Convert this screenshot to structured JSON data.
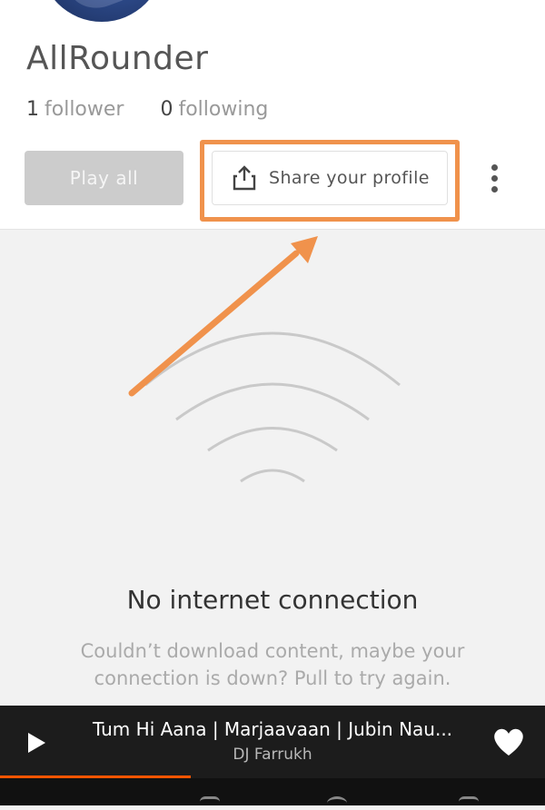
{
  "profile": {
    "username": "AllRounder",
    "followers_count": "1",
    "followers_label": "follower",
    "following_count": "0",
    "following_label": "following"
  },
  "actions": {
    "play_all_label": "Play all",
    "share_label": "Share your profile"
  },
  "empty_state": {
    "title": "No internet connection",
    "message": "Couldn’t download content, maybe your connection is down? Pull to try again."
  },
  "player": {
    "track_title": "Tum Hi Aana | Marjaavaan | Jubin Nau...",
    "artist": "DJ Farrukh",
    "progress_fraction": 0.35
  },
  "colors": {
    "highlight": "#f0924c",
    "accent": "#ff5500",
    "player_bg": "#1c1c1c"
  },
  "icons": {
    "share": "share-icon",
    "more": "more-vertical-icon",
    "play": "play-icon",
    "heart": "heart-icon",
    "signal": "no-signal-icon"
  }
}
